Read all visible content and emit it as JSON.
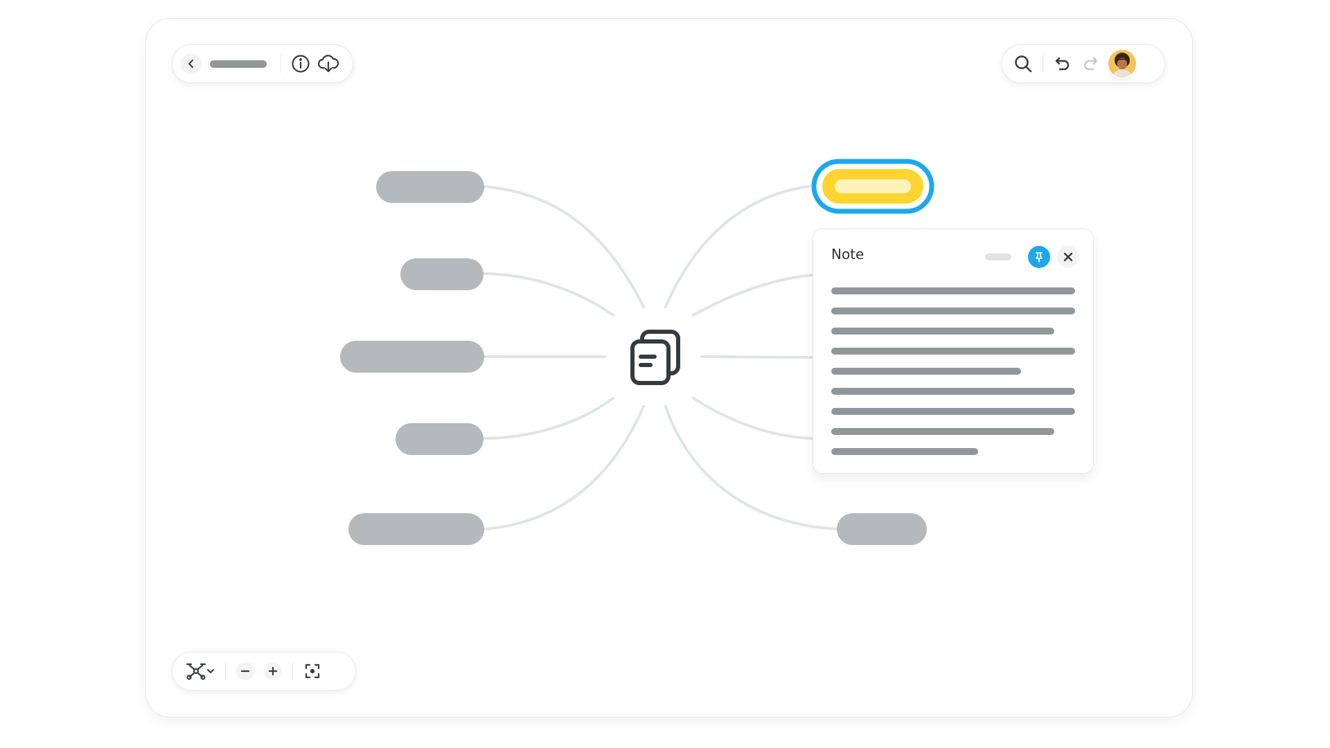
{
  "app": {
    "title_placeholder": "",
    "accent_color": "#1ea7ec",
    "highlight_color": "#fed530"
  },
  "top_left_toolbar": {
    "icons": [
      "chevron-left-icon",
      "info-icon",
      "cloud-download-icon"
    ]
  },
  "top_right_toolbar": {
    "icons": [
      "search-icon",
      "undo-icon",
      "redo-icon",
      "avatar"
    ]
  },
  "bottom_toolbar": {
    "icons": [
      "mindmap-layout-icon",
      "chevron-down-icon",
      "zoom-out-icon",
      "zoom-in-icon",
      "fit-screen-icon"
    ]
  },
  "central_node": {
    "icon": "documents-icon"
  },
  "note_panel": {
    "title": "Note",
    "icons": [
      "pin-icon",
      "close-icon"
    ]
  }
}
